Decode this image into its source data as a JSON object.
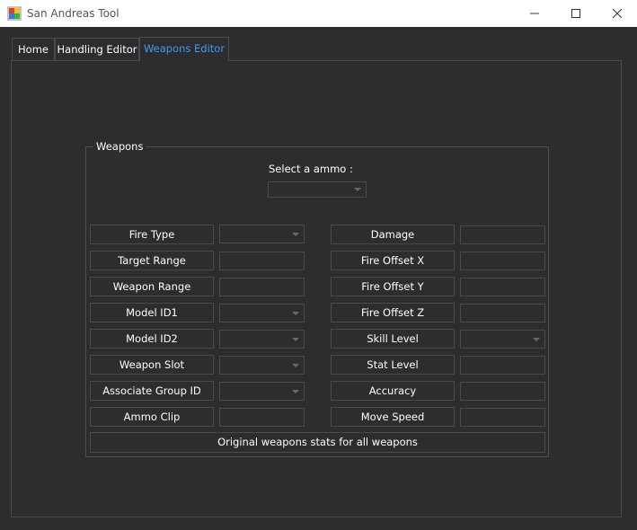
{
  "window": {
    "title": "San Andreas Tool",
    "minimize_icon": "minimize-icon",
    "maximize_icon": "maximize-icon",
    "close_icon": "close-icon"
  },
  "tabs": [
    {
      "label": "Home",
      "active": false
    },
    {
      "label": "Handling Editor",
      "active": false
    },
    {
      "label": "Weapons Editor",
      "active": true
    }
  ],
  "colors": {
    "background": "#2d2d30",
    "active_tab_text": "#3d9bf0",
    "border": "#4a4a4e"
  },
  "weapons": {
    "group_title": "Weapons",
    "ammo_label": "Select a ammo :",
    "ammo_value": "",
    "left_fields": [
      {
        "label": "Fire Type",
        "type": "combo",
        "value": ""
      },
      {
        "label": "Target Range",
        "type": "text",
        "value": ""
      },
      {
        "label": "Weapon Range",
        "type": "text",
        "value": ""
      },
      {
        "label": "Model ID1",
        "type": "combo",
        "value": ""
      },
      {
        "label": "Model ID2",
        "type": "combo",
        "value": ""
      },
      {
        "label": "Weapon Slot",
        "type": "combo",
        "value": ""
      },
      {
        "label": "Associate Group ID",
        "type": "combo",
        "value": ""
      },
      {
        "label": "Ammo Clip",
        "type": "text",
        "value": ""
      }
    ],
    "right_fields": [
      {
        "label": "Damage",
        "type": "text",
        "value": ""
      },
      {
        "label": "Fire Offset X",
        "type": "text",
        "value": ""
      },
      {
        "label": "Fire Offset Y",
        "type": "text",
        "value": ""
      },
      {
        "label": "Fire Offset Z",
        "type": "text",
        "value": ""
      },
      {
        "label": "Skill Level",
        "type": "combo",
        "value": ""
      },
      {
        "label": "Stat Level",
        "type": "text",
        "value": ""
      },
      {
        "label": "Accuracy",
        "type": "text",
        "value": ""
      },
      {
        "label": "Move Speed",
        "type": "text",
        "value": ""
      }
    ],
    "reset_button_label": "Original weapons stats for all weapons"
  }
}
